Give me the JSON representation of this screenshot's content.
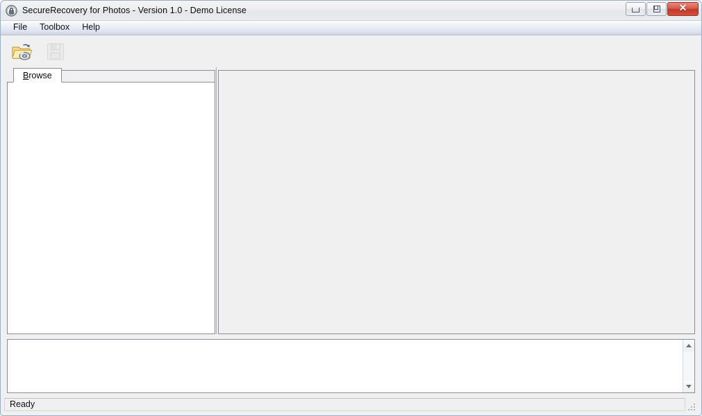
{
  "window": {
    "title": "SecureRecovery for Photos - Version 1.0 - Demo License",
    "app_icon": "padlock-icon",
    "accent_close_color": "#c0392a",
    "titlebar_color": "#eceef0",
    "controls": {
      "minimize_label": "",
      "restore_label": "",
      "close_label": "✕",
      "minimize_name": "minimize",
      "restore_name": "restore",
      "close_name": "close"
    }
  },
  "menubar": {
    "items": [
      {
        "label": "File",
        "name": "file"
      },
      {
        "label": "Toolbox",
        "name": "toolbox"
      },
      {
        "label": "Help",
        "name": "help"
      }
    ]
  },
  "toolbar": {
    "buttons": [
      {
        "name": "open-drive-button",
        "icon": "open-folder-drive-icon",
        "enabled": true,
        "tooltip": "Open"
      },
      {
        "name": "save-button",
        "icon": "save-floppy-icon",
        "enabled": false,
        "tooltip": "Save"
      }
    ]
  },
  "main": {
    "tabs": [
      {
        "label": "Browse",
        "accel": "B",
        "rest": "rowse",
        "selected": true,
        "name": "browse"
      }
    ],
    "browse_panel": {
      "content": ""
    },
    "preview_panel": {
      "content": ""
    }
  },
  "log": {
    "content": "",
    "scrollbar": {
      "up_arrow": "scroll-up-arrow",
      "down_arrow": "scroll-down-arrow"
    }
  },
  "statusbar": {
    "text": "Ready",
    "grip": "resize-grip"
  }
}
